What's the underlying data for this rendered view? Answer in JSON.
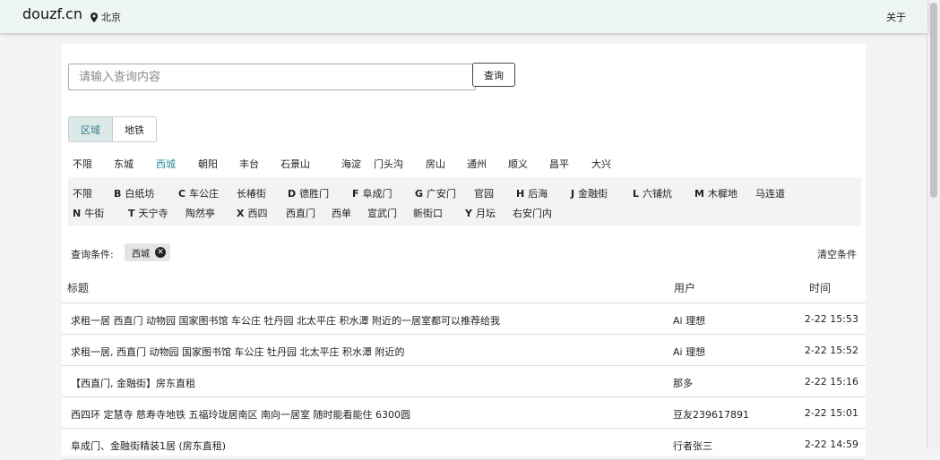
{
  "navbar": {
    "brand": "douzf.cn",
    "location": "北京",
    "about": "关于"
  },
  "search": {
    "placeholder": "请输入查询内容",
    "button": "查询"
  },
  "mode_tabs": [
    "区域",
    "地铁"
  ],
  "districts": [
    "不限",
    "东城",
    "西城",
    "朝阳",
    "丰台",
    "石景山",
    "海淀",
    "门头沟",
    "房山",
    "通州",
    "顺义",
    "昌平",
    "大兴"
  ],
  "sub_areas": {
    "row1": [
      {
        "letter": "",
        "name": "不限"
      },
      {
        "letter": "B",
        "name": "白纸坊"
      },
      {
        "letter": "C",
        "name": "车公庄"
      },
      {
        "letter": "",
        "name": "长椿街"
      },
      {
        "letter": "D",
        "name": "德胜门"
      },
      {
        "letter": "F",
        "name": "阜成门"
      },
      {
        "letter": "G",
        "name": "广安门"
      },
      {
        "letter": "",
        "name": "官园"
      },
      {
        "letter": "H",
        "name": "后海"
      },
      {
        "letter": "J",
        "name": "金融街"
      },
      {
        "letter": "L",
        "name": "六铺炕"
      },
      {
        "letter": "M",
        "name": "木樨地"
      },
      {
        "letter": "",
        "name": "马连道"
      }
    ],
    "row2": [
      {
        "letter": "N",
        "name": "牛街"
      },
      {
        "letter": "T",
        "name": "天宁寺"
      },
      {
        "letter": "",
        "name": "陶然亭"
      },
      {
        "letter": "X",
        "name": "西四"
      },
      {
        "letter": "",
        "name": "西直门"
      },
      {
        "letter": "",
        "name": "西单"
      },
      {
        "letter": "",
        "name": "宣武门"
      },
      {
        "letter": "",
        "name": "新街口"
      },
      {
        "letter": "Y",
        "name": "月坛"
      },
      {
        "letter": "",
        "name": "右安门内"
      }
    ]
  },
  "conditions": {
    "label": "查询条件:",
    "chip": "西城",
    "clear": "清空条件"
  },
  "table": {
    "headers": [
      "标题",
      "用户",
      "时间"
    ],
    "rows": [
      [
        "求租一居 西直门 动物园 国家图书馆 车公庄 牡丹园 北太平庄 积水潭 附近的一居室都可以推荐给我",
        "Ai 理想",
        "2-22 15:53"
      ],
      [
        "求租一居, 西直门 动物园 国家图书馆 车公庄 牡丹园 北太平庄 积水潭 附近的",
        "Ai 理想",
        "2-22 15:52"
      ],
      [
        "【西直门, 金融街】房东直租",
        "那多",
        "2-22 15:16"
      ],
      [
        "西四环 定慧寺 慈寿寺地铁 五福玲珑居南区 南向一居室 随时能看能住 6300圆",
        "豆友239617891",
        "2-22 15:01"
      ],
      [
        "阜成门、金融街精装1居 (房东直租)",
        "行者张三",
        "2-22 14:59"
      ]
    ]
  },
  "colors": {
    "navbar_bg": "#eef6f1",
    "accent": "#2c8a9a"
  }
}
